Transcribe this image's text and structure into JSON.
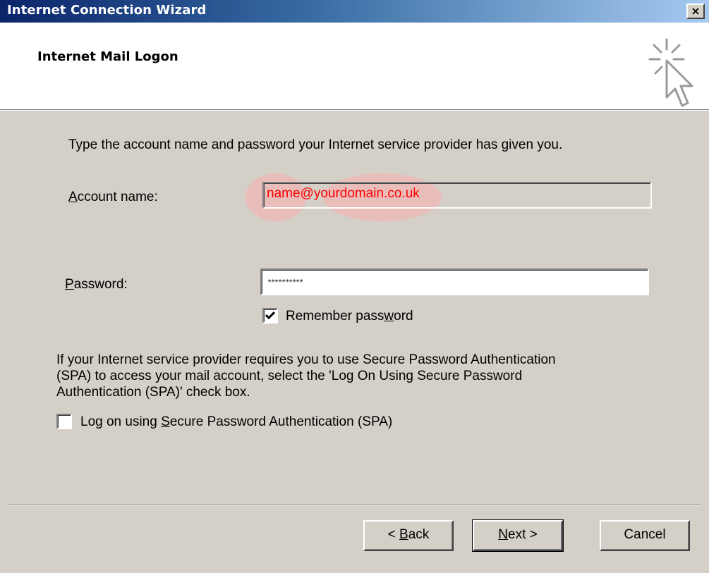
{
  "window": {
    "title": "Internet Connection Wizard",
    "close_glyph": "×"
  },
  "header": {
    "title": "Internet Mail Logon",
    "icon": "wizard-cursor-icon"
  },
  "content": {
    "instruction": "Type the account name and password your Internet service provider has given you.",
    "account_label_mnemonic": "A",
    "account_label_rest": "ccount name:",
    "account_value": "name@yourdomain.co.uk",
    "password_label_mnemonic": "P",
    "password_label_rest": "assword:",
    "password_value": "**********",
    "remember_label_pre": "Remember pass",
    "remember_label_mnemonic": "w",
    "remember_label_post": "ord",
    "remember_checked": true,
    "spa_info_line1": "If your Internet service provider requires you to use Secure Password Authentication",
    "spa_info_line2": "(SPA) to access your mail account, select the 'Log On Using Secure Password",
    "spa_info_line3": "Authentication (SPA)' check box.",
    "spa_label_pre": "Log on using ",
    "spa_label_mnemonic": "S",
    "spa_label_post": "ecure Password Authentication (SPA)",
    "spa_checked": false,
    "highlight_color": "#faafaf"
  },
  "buttons": {
    "back_pre": "< ",
    "back_mnemonic": "B",
    "back_post": "ack",
    "next_mnemonic": "N",
    "next_post": "ext >",
    "cancel": "Cancel"
  },
  "colors": {
    "titlebar_start": "#0a246a",
    "titlebar_end": "#a6caf0",
    "dialog_bg": "#d4d0c8",
    "account_text": "#ff0000"
  }
}
